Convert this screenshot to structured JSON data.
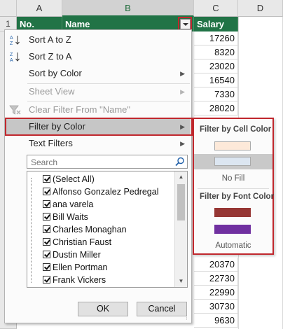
{
  "columns": {
    "a": "A",
    "b": "B",
    "c": "C",
    "d": "D"
  },
  "row_number": "1",
  "headers": {
    "no": "No.",
    "name": "Name",
    "salary": "Salary"
  },
  "salaries": [
    "17260",
    "8320",
    "23020",
    "16540",
    "7330",
    "28020",
    "20370",
    "22730",
    "22990",
    "30730",
    "9630"
  ],
  "menu": {
    "sort_az": "Sort A to Z",
    "sort_za": "Sort Z to A",
    "sort_by_color": "Sort by Color",
    "sheet_view": "Sheet View",
    "clear_filter": "Clear Filter From \"Name\"",
    "filter_by_color": "Filter by Color",
    "text_filters": "Text Filters",
    "search_placeholder": "Search",
    "items": [
      "(Select All)",
      "Alfonso Gonzalez Pedregal",
      "ana varela",
      "Bill Waits",
      "Charles Monaghan",
      "Christian Faust",
      "Dustin Miller",
      "Ellen Portman",
      "Frank Vickers"
    ],
    "ok": "OK",
    "cancel": "Cancel"
  },
  "submenu": {
    "cell_color_header": "Filter by Cell Color",
    "cell_colors": [
      "#fde9d9",
      "#dce6f1"
    ],
    "no_fill": "No Fill",
    "font_color_header": "Filter by Font Color",
    "font_colors": [
      "#963634",
      "#7030a0"
    ],
    "automatic": "Automatic"
  },
  "colors": {
    "header_green": "#217346",
    "highlight_red": "#c0272d"
  }
}
